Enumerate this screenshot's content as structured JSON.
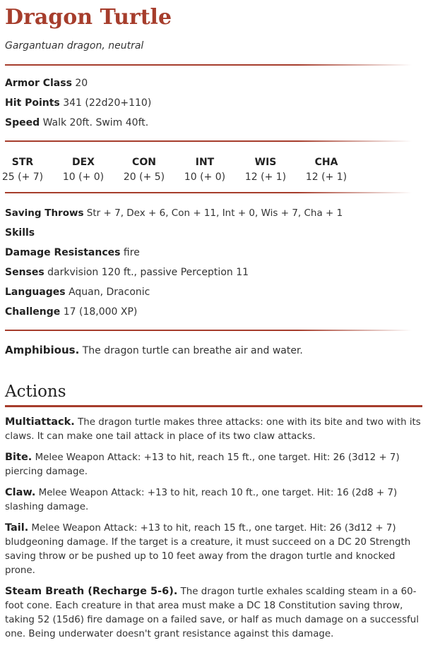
{
  "monster": {
    "name": "Dragon Turtle",
    "meta": "Gargantuan dragon, neutral"
  },
  "basics": {
    "armor_class": {
      "label": "Armor Class",
      "value": "20"
    },
    "hit_points": {
      "label": "Hit Points",
      "value": "341 (22d20+110)"
    },
    "speed": {
      "label": "Speed",
      "value": "Walk 20ft. Swim 40ft."
    }
  },
  "abilities": [
    {
      "name": "STR",
      "value": "25 (+ 7)"
    },
    {
      "name": "DEX",
      "value": "10 (+ 0)"
    },
    {
      "name": "CON",
      "value": "20 (+ 5)"
    },
    {
      "name": "INT",
      "value": "10 (+ 0)"
    },
    {
      "name": "WIS",
      "value": "12 (+ 1)"
    },
    {
      "name": "CHA",
      "value": "12 (+ 1)"
    }
  ],
  "details": {
    "saving_throws": {
      "label": "Saving Throws",
      "value": "Str + 7, Dex + 6, Con + 11, Int + 0, Wis + 7, Cha + 1"
    },
    "skills": {
      "label": "Skills",
      "value": ""
    },
    "damage_resistances": {
      "label": "Damage Resistances",
      "value": "fire"
    },
    "senses": {
      "label": "Senses",
      "value": "darkvision 120 ft., passive Perception 11"
    },
    "languages": {
      "label": "Languages",
      "value": "Aquan, Draconic"
    },
    "challenge": {
      "label": "Challenge",
      "value": "17 (18,000 XP)"
    }
  },
  "traits": [
    {
      "name": "Amphibious.",
      "text": "The dragon turtle can breathe air and water."
    }
  ],
  "actions_heading": "Actions",
  "actions": [
    {
      "name": "Multiattack.",
      "text": "The dragon turtle makes three attacks: one with its bite and two with its claws. It can make one tail attack in place of its two claw attacks."
    },
    {
      "name": "Bite.",
      "text": "Melee Weapon Attack: +13 to hit, reach 15 ft., one target. Hit: 26 (3d12 + 7) piercing damage."
    },
    {
      "name": "Claw.",
      "text": "Melee Weapon Attack: +13 to hit, reach 10 ft., one target. Hit: 16 (2d8 + 7) slashing damage."
    },
    {
      "name": "Tail.",
      "text": "Melee Weapon Attack: +13 to hit, reach 15 ft., one target. Hit: 26 (3d12 + 7) bludgeoning damage. If the target is a creature, it must succeed on a DC 20 Strength saving throw or be pushed up to 10 feet away from the dragon turtle and knocked prone."
    },
    {
      "name": "Steam Breath (Recharge 5-6).",
      "text": "The dragon turtle exhales scalding steam in a 60-foot cone. Each creature in that area must make a DC 18 Constitution saving throw, taking 52 (15d6) fire damage on a failed save, or half as much damage on a successful one. Being underwater doesn't grant resistance against this damage."
    }
  ],
  "colors": {
    "accent": "#a63d2c",
    "text": "#222222"
  }
}
